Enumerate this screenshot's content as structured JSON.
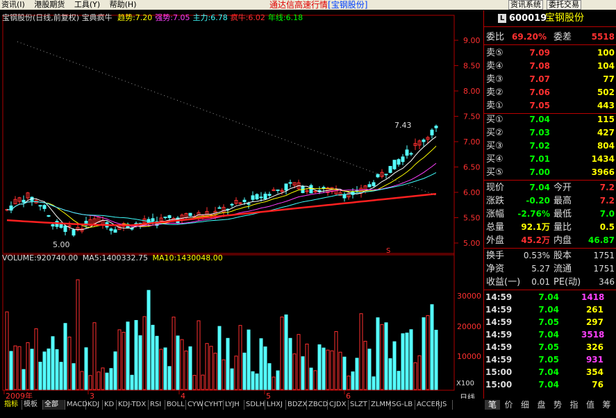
{
  "menu": {
    "items": [
      "资讯(I)",
      "港股期货",
      "工具(Y)",
      "帮助(H)"
    ],
    "title": "通达信高速行情",
    "title_stock": "[宝钢股份]",
    "right_buttons": [
      "资讯系统",
      "委托交易"
    ]
  },
  "legend": {
    "name": "宝钢股份(日线,前复权)",
    "indicator": "宝典疯牛",
    "items": [
      {
        "label": "趋势:7.20",
        "color": "#ffff00"
      },
      {
        "label": "强势:7.05",
        "color": "#ff40ff"
      },
      {
        "label": "主力:6.78",
        "color": "#40ffff"
      },
      {
        "label": "疯牛:6.02",
        "color": "#ff3030"
      },
      {
        "label": "年线:6.18",
        "color": "#00ff00"
      }
    ]
  },
  "volume_legend": {
    "vol": "VOLUME:920740.00",
    "ma5": "MA5:1400332.75",
    "ma10": "MA10:1430048.00"
  },
  "price_axis": [
    "9.00",
    "8.50",
    "8.00",
    "7.50",
    "7.00",
    "6.50",
    "6.00",
    "5.50",
    "5.00"
  ],
  "volume_axis": [
    "30000",
    "20000",
    "10000"
  ],
  "volume_unit": "X100",
  "period_label": "日线",
  "time_axis": [
    "2009年",
    "3",
    "4",
    "5",
    "6"
  ],
  "annotations": {
    "high": "7.43",
    "low": "5.00",
    "marker": "S"
  },
  "quote": {
    "code_badge": "L",
    "code": "600019",
    "name": "宝钢股份",
    "weibi_label": "委比",
    "weibi": "69.20%",
    "weicha_label": "委差",
    "weicha": "5518",
    "sell": [
      {
        "label": "卖⑤",
        "price": "7.09",
        "vol": "100"
      },
      {
        "label": "卖④",
        "price": "7.08",
        "vol": "104"
      },
      {
        "label": "卖③",
        "price": "7.07",
        "vol": "77"
      },
      {
        "label": "卖②",
        "price": "7.06",
        "vol": "502"
      },
      {
        "label": "卖①",
        "price": "7.05",
        "vol": "443"
      }
    ],
    "buy": [
      {
        "label": "买①",
        "price": "7.04",
        "vol": "115"
      },
      {
        "label": "买②",
        "price": "7.03",
        "vol": "427"
      },
      {
        "label": "买③",
        "price": "7.02",
        "vol": "804"
      },
      {
        "label": "买④",
        "price": "7.01",
        "vol": "1434"
      },
      {
        "label": "买⑤",
        "price": "7.00",
        "vol": "3966"
      }
    ],
    "stats": [
      {
        "l1": "现价",
        "v1": "7.04",
        "c1": "#00ff00",
        "l2": "今开",
        "v2": "7.2",
        "c2": "#ff3030"
      },
      {
        "l1": "涨跌",
        "v1": "-0.20",
        "c1": "#00ff00",
        "l2": "最高",
        "v2": "7.2",
        "c2": "#ff3030"
      },
      {
        "l1": "涨幅",
        "v1": "-2.76%",
        "c1": "#00ff00",
        "l2": "最低",
        "v2": "7.0",
        "c2": "#00ff00"
      },
      {
        "l1": "总量",
        "v1": "92.1万",
        "c1": "#ffff00",
        "l2": "量比",
        "v2": "0.5",
        "c2": "#ffff00"
      },
      {
        "l1": "外盘",
        "v1": "45.2万",
        "c1": "#ff3030",
        "l2": "内盘",
        "v2": "46.87",
        "c2": "#00ff00"
      }
    ],
    "info": [
      {
        "l1": "换手",
        "v1": "0.53%",
        "l2": "股本",
        "v2": "1751"
      },
      {
        "l1": "净资",
        "v1": "5.27",
        "l2": "流通",
        "v2": "1751"
      },
      {
        "l1": "收益(一)",
        "v1": "0.01",
        "l2": "PE(动)",
        "v2": "346"
      }
    ],
    "ticks": [
      {
        "time": "14:59",
        "price": "7.04",
        "vol": "1418",
        "vc": "#ff40ff"
      },
      {
        "time": "14:59",
        "price": "7.04",
        "vol": "261",
        "vc": "#ffff00"
      },
      {
        "time": "14:59",
        "price": "7.05",
        "vol": "297",
        "vc": "#ffff00"
      },
      {
        "time": "14:59",
        "price": "7.04",
        "vol": "3518",
        "vc": "#ff40ff"
      },
      {
        "time": "14:59",
        "price": "7.05",
        "vol": "326",
        "vc": "#ffff00"
      },
      {
        "time": "14:59",
        "price": "7.05",
        "vol": "931",
        "vc": "#ff40ff"
      },
      {
        "time": "15:00",
        "price": "7.04",
        "vol": "354",
        "vc": "#ffff00"
      },
      {
        "time": "15:00",
        "price": "7.04",
        "vol": "76",
        "vc": "#ffff00"
      }
    ]
  },
  "bottom_tabs": [
    "指标",
    "模板",
    "全部",
    "MACD",
    "KDJ",
    "KD",
    "KDJ-TDX",
    "RSI",
    "BOLL",
    "CYW",
    "CYHT",
    "LYJH",
    "SDLH",
    "LHXJ",
    "BDZX",
    "ZBCD",
    "CJDX",
    "SLZT",
    "ZLMM",
    "SG-LB",
    "ACCER",
    "JS"
  ],
  "active_tab": "全部",
  "panel_tabs": [
    "笔",
    "价",
    "细",
    "盘",
    "势",
    "指",
    "值",
    "筹"
  ],
  "colors": {
    "up": "#ff3030",
    "down": "#54ffff",
    "border": "#b00000"
  }
}
